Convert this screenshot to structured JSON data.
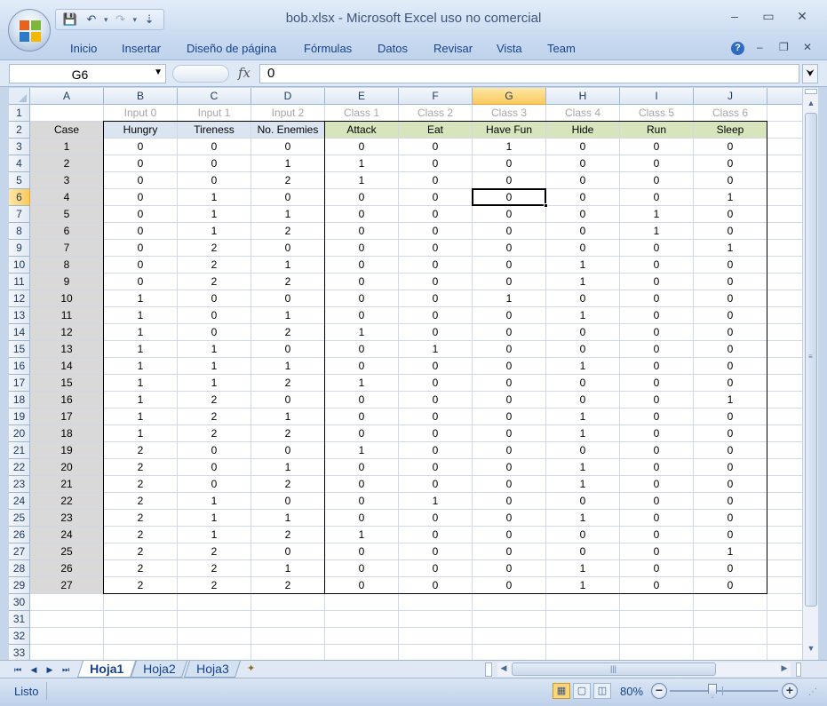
{
  "window": {
    "title": "bob.xlsx - Microsoft Excel uso no comercial",
    "minimize": "–",
    "maximize": "▭",
    "close": "✕"
  },
  "qat": {
    "save": "💾",
    "undo": "↶",
    "redo": "↷",
    "dropdown": "▾",
    "customize": "⇣"
  },
  "ribbon": {
    "tabs": [
      "Inicio",
      "Insertar",
      "Diseño de página",
      "Fórmulas",
      "Datos",
      "Revisar",
      "Vista",
      "Team"
    ],
    "help": "?",
    "wb_minimize": "–",
    "wb_restore": "❐",
    "wb_close": "✕"
  },
  "formula_bar": {
    "name_box": "G6",
    "fx": "fx",
    "value": "0",
    "expand": "⮟"
  },
  "columns": [
    "A",
    "B",
    "C",
    "D",
    "E",
    "F",
    "G",
    "H",
    "I",
    "J"
  ],
  "active_cell": {
    "col": "G",
    "row": 6
  },
  "rows": [
    "1",
    "2",
    "3",
    "4",
    "5",
    "6",
    "7",
    "8",
    "9",
    "10",
    "11",
    "12",
    "13",
    "14",
    "15",
    "16",
    "17",
    "18",
    "19",
    "20",
    "21",
    "22",
    "23",
    "24",
    "25",
    "26",
    "27",
    "28",
    "29",
    "30",
    "31",
    "32",
    "33"
  ],
  "sheet": {
    "row1": [
      "",
      "Input 0",
      "Input 1",
      "Input 2",
      "Class 1",
      "Class 2",
      "Class 3",
      "Class 4",
      "Class 5",
      "Class 6"
    ],
    "header": [
      "Case",
      "Hungry",
      "Tireness",
      "No. Enemies",
      "Attack",
      "Eat",
      "Have Fun",
      "Hide",
      "Run",
      "Sleep"
    ],
    "data": [
      [
        "1",
        "0",
        "0",
        "0",
        "0",
        "0",
        "1",
        "0",
        "0",
        "0"
      ],
      [
        "2",
        "0",
        "0",
        "1",
        "1",
        "0",
        "0",
        "0",
        "0",
        "0"
      ],
      [
        "3",
        "0",
        "0",
        "2",
        "1",
        "0",
        "0",
        "0",
        "0",
        "0"
      ],
      [
        "4",
        "0",
        "1",
        "0",
        "0",
        "0",
        "0",
        "0",
        "0",
        "1"
      ],
      [
        "5",
        "0",
        "1",
        "1",
        "0",
        "0",
        "0",
        "0",
        "1",
        "0"
      ],
      [
        "6",
        "0",
        "1",
        "2",
        "0",
        "0",
        "0",
        "0",
        "1",
        "0"
      ],
      [
        "7",
        "0",
        "2",
        "0",
        "0",
        "0",
        "0",
        "0",
        "0",
        "1"
      ],
      [
        "8",
        "0",
        "2",
        "1",
        "0",
        "0",
        "0",
        "1",
        "0",
        "0"
      ],
      [
        "9",
        "0",
        "2",
        "2",
        "0",
        "0",
        "0",
        "1",
        "0",
        "0"
      ],
      [
        "10",
        "1",
        "0",
        "0",
        "0",
        "0",
        "1",
        "0",
        "0",
        "0"
      ],
      [
        "11",
        "1",
        "0",
        "1",
        "0",
        "0",
        "0",
        "1",
        "0",
        "0"
      ],
      [
        "12",
        "1",
        "0",
        "2",
        "1",
        "0",
        "0",
        "0",
        "0",
        "0"
      ],
      [
        "13",
        "1",
        "1",
        "0",
        "0",
        "1",
        "0",
        "0",
        "0",
        "0"
      ],
      [
        "14",
        "1",
        "1",
        "1",
        "0",
        "0",
        "0",
        "1",
        "0",
        "0"
      ],
      [
        "15",
        "1",
        "1",
        "2",
        "1",
        "0",
        "0",
        "0",
        "0",
        "0"
      ],
      [
        "16",
        "1",
        "2",
        "0",
        "0",
        "0",
        "0",
        "0",
        "0",
        "1"
      ],
      [
        "17",
        "1",
        "2",
        "1",
        "0",
        "0",
        "0",
        "1",
        "0",
        "0"
      ],
      [
        "18",
        "1",
        "2",
        "2",
        "0",
        "0",
        "0",
        "1",
        "0",
        "0"
      ],
      [
        "19",
        "2",
        "0",
        "0",
        "1",
        "0",
        "0",
        "0",
        "0",
        "0"
      ],
      [
        "20",
        "2",
        "0",
        "1",
        "0",
        "0",
        "0",
        "1",
        "0",
        "0"
      ],
      [
        "21",
        "2",
        "0",
        "2",
        "0",
        "0",
        "0",
        "1",
        "0",
        "0"
      ],
      [
        "22",
        "2",
        "1",
        "0",
        "0",
        "1",
        "0",
        "0",
        "0",
        "0"
      ],
      [
        "23",
        "2",
        "1",
        "1",
        "0",
        "0",
        "0",
        "1",
        "0",
        "0"
      ],
      [
        "24",
        "2",
        "1",
        "2",
        "1",
        "0",
        "0",
        "0",
        "0",
        "0"
      ],
      [
        "25",
        "2",
        "2",
        "0",
        "0",
        "0",
        "0",
        "0",
        "0",
        "1"
      ],
      [
        "26",
        "2",
        "2",
        "1",
        "0",
        "0",
        "0",
        "1",
        "0",
        "0"
      ],
      [
        "27",
        "2",
        "2",
        "2",
        "0",
        "0",
        "0",
        "1",
        "0",
        "0"
      ]
    ]
  },
  "sheet_tabs": [
    "Hoja1",
    "Hoja2",
    "Hoja3"
  ],
  "active_sheet": "Hoja1",
  "status": {
    "mode": "Listo",
    "zoom": "80%",
    "zoom_out": "−",
    "zoom_in": "+"
  },
  "colors": {
    "case_fill": "#d9d9d9",
    "input_fill": "#dbe5f1",
    "class_fill": "#d8e4bc",
    "active_header": "#f8c95e"
  }
}
